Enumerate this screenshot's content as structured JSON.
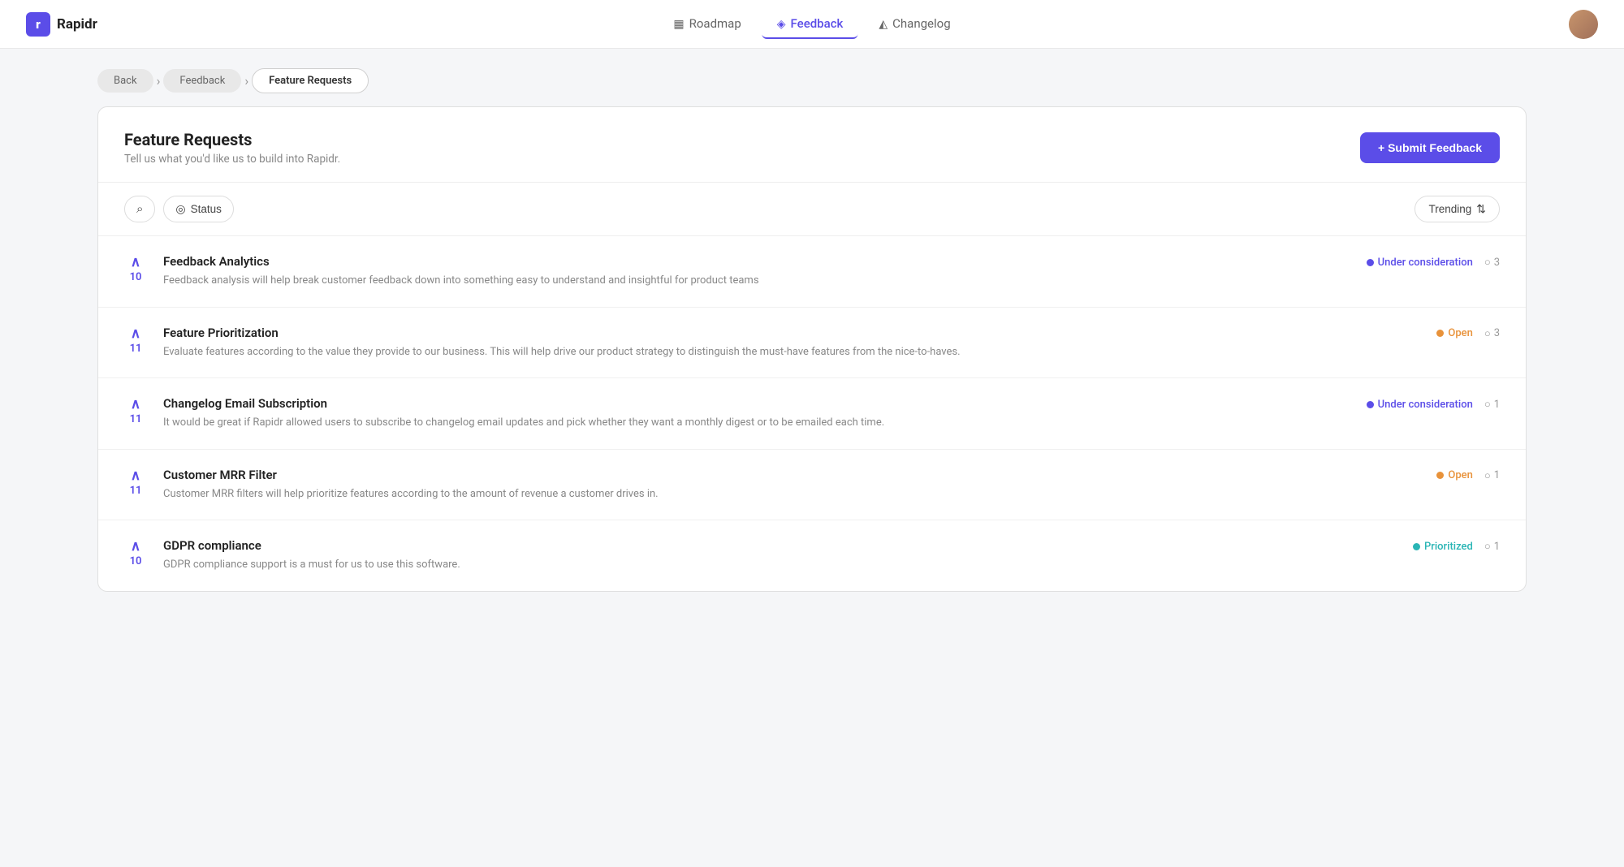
{
  "app": {
    "logo_letter": "r",
    "name": "Rapidr"
  },
  "navbar": {
    "items": [
      {
        "id": "roadmap",
        "label": "Roadmap",
        "icon": "roadmap-icon",
        "active": false
      },
      {
        "id": "feedback",
        "label": "Feedback",
        "icon": "feedback-icon",
        "active": true
      },
      {
        "id": "changelog",
        "label": "Changelog",
        "icon": "changelog-icon",
        "active": false
      }
    ],
    "avatar_alt": "User avatar"
  },
  "breadcrumb": {
    "items": [
      {
        "id": "back",
        "label": "Back",
        "active": false
      },
      {
        "id": "feedback",
        "label": "Feedback",
        "active": false
      },
      {
        "id": "feature-requests",
        "label": "Feature Requests",
        "active": true
      }
    ]
  },
  "page": {
    "title": "Feature Requests",
    "subtitle": "Tell us what you'd like us to build into Rapidr.",
    "submit_button": "+ Submit Feedback"
  },
  "filters": {
    "search_label": "Search",
    "status_label": "Status",
    "sort_label": "Trending",
    "sort_icon": "sort-icon"
  },
  "feedback_items": [
    {
      "id": 1,
      "title": "Feedback Analytics",
      "description": "Feedback analysis will help break customer feedback down into something easy to understand and insightful for product teams",
      "votes": 10,
      "status": "Under consideration",
      "status_type": "blue",
      "comments": 3
    },
    {
      "id": 2,
      "title": "Feature Prioritization",
      "description": "Evaluate features according to the value they provide to our business. This will help drive our product strategy to distinguish the must-have features from the nice-to-haves.",
      "votes": 11,
      "status": "Open",
      "status_type": "orange",
      "comments": 3
    },
    {
      "id": 3,
      "title": "Changelog Email Subscription",
      "description": "It would be great if Rapidr allowed users to subscribe to changelog email updates and pick whether they want a monthly digest or to be emailed each time.",
      "votes": 11,
      "status": "Under consideration",
      "status_type": "blue",
      "comments": 1
    },
    {
      "id": 4,
      "title": "Customer MRR Filter",
      "description": "Customer MRR filters will help prioritize features according to the amount of revenue a customer drives in.",
      "votes": 11,
      "status": "Open",
      "status_type": "orange",
      "comments": 1
    },
    {
      "id": 5,
      "title": "GDPR compliance",
      "description": "GDPR compliance support is a must for us to use this software.",
      "votes": 10,
      "status": "Prioritized",
      "status_type": "teal",
      "comments": 1
    }
  ]
}
